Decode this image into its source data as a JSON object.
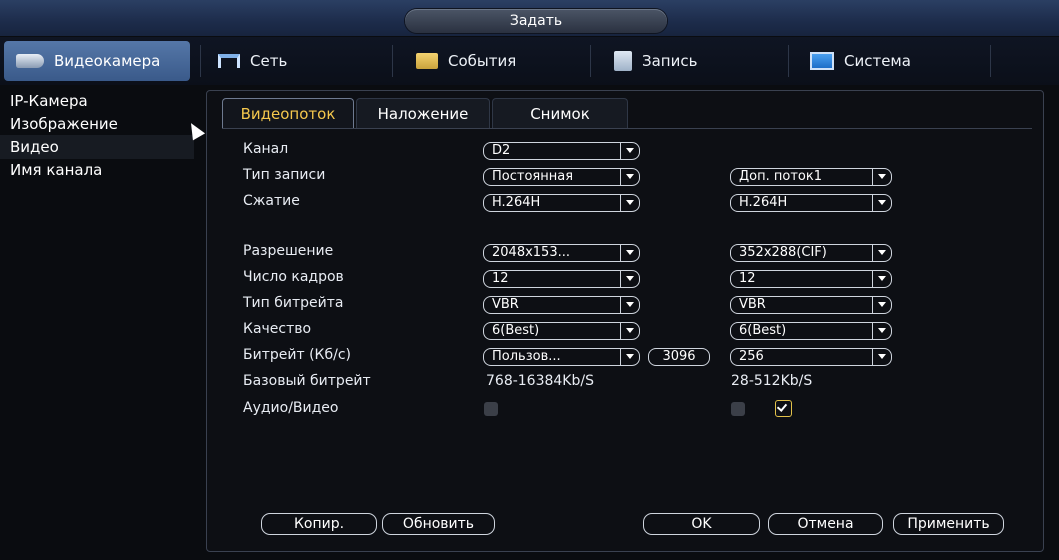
{
  "window": {
    "title": "Задать"
  },
  "nav": [
    {
      "label": "Видеокамера",
      "icon": "camera-icon",
      "active": true
    },
    {
      "label": "Сеть",
      "icon": "network-icon"
    },
    {
      "label": "События",
      "icon": "events-icon"
    },
    {
      "label": "Запись",
      "icon": "record-icon"
    },
    {
      "label": "Система",
      "icon": "system-icon"
    }
  ],
  "sidebar": [
    {
      "label": "IP-Камера"
    },
    {
      "label": "Изображение"
    },
    {
      "label": "Видео",
      "active": true
    },
    {
      "label": "Имя канала"
    }
  ],
  "tabs": [
    {
      "label": "Видеопоток",
      "active": true
    },
    {
      "label": "Наложение"
    },
    {
      "label": "Снимок"
    }
  ],
  "form": {
    "channel": {
      "label": "Канал",
      "value": "D2"
    },
    "record_type": {
      "label": "Тип записи",
      "main": "Постоянная",
      "extra": "Доп. поток1"
    },
    "compression": {
      "label": "Сжатие",
      "main": "H.264H",
      "extra": "H.264H"
    },
    "resolution": {
      "label": "Разрешение",
      "main": "2048x153...",
      "extra": "352x288(CIF)"
    },
    "fps": {
      "label": "Число кадров",
      "main": "12",
      "extra": "12"
    },
    "bitrate_type": {
      "label": "Тип битрейта",
      "main": "VBR",
      "extra": "VBR"
    },
    "quality": {
      "label": "Качество",
      "main": "6(Best)",
      "extra": "6(Best)"
    },
    "bitrate": {
      "label": "Битрейт (Кб/с)",
      "main": "Пользов...",
      "main_value": "3096",
      "extra": "256"
    },
    "base_bitrate": {
      "label": "Базовый битрейт",
      "main": "768-16384Kb/S",
      "extra": "28-512Kb/S"
    },
    "audio_video": {
      "label": "Аудио/Видео",
      "main_checked": false,
      "extra_checked": false,
      "extra2_checked": true
    }
  },
  "buttons": {
    "copy": "Копир.",
    "refresh": "Обновить",
    "ok": "OK",
    "cancel": "Отмена",
    "apply": "Применить"
  }
}
